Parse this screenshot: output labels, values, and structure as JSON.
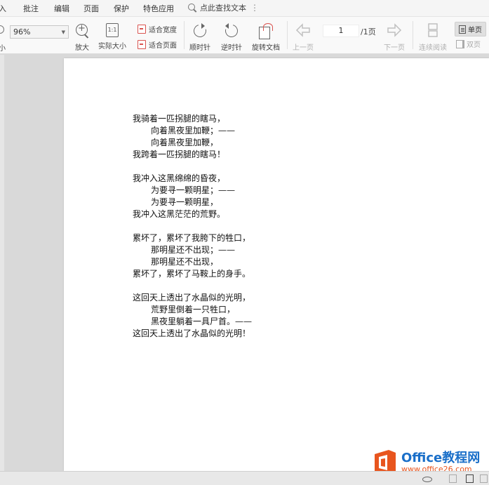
{
  "menu": {
    "items": [
      "入",
      "批注",
      "编辑",
      "页面",
      "保护",
      "特色应用"
    ],
    "search_label": "点此查找文本",
    "kebab": "⋮"
  },
  "toolbar": {
    "zoom_out_label": "小",
    "zoom_value": "96%",
    "zoom_in_label": "放大",
    "actual_size_label": "实际大小",
    "actual_size_icon_text": "1:1",
    "fit_width_label": "适合宽度",
    "fit_page_label": "适合页面",
    "rotate_cw_label": "顺时针",
    "rotate_ccw_label": "逆时针",
    "rotate_doc_label": "旋转文档",
    "prev_page_label": "上一页",
    "current_page": "1",
    "total_pages": "/1页",
    "next_page_label": "下一页",
    "continuous_label": "连续阅读",
    "single_page_label": "单页",
    "double_page_label": "双页"
  },
  "document": {
    "stanzas": [
      [
        "我骑着一匹拐腿的瞎马，",
        "向着黑夜里加鞭；——",
        "向着黑夜里加鞭，",
        "我跨着一匹拐腿的瞎马！"
      ],
      [
        "我冲入这黑绵绵的昏夜，",
        "为要寻一颗明星；——",
        "为要寻一颗明星，",
        "我冲入这黑茫茫的荒野。"
      ],
      [
        "累坏了，累坏了我胯下的牲口，",
        "那明星还不出现；——",
        "那明星还不出现，",
        "累坏了，累坏了马鞍上的身手。"
      ],
      [
        "这回天上透出了水晶似的光明，",
        "荒野里倒着一只牲口，",
        "黑夜里躺着一具尸首。——",
        "这回天上透出了水晶似的光明！"
      ]
    ]
  },
  "watermark": {
    "main": "Office教程网",
    "sub": "www.office26.com",
    "colors": {
      "blue": "#1a6fc9",
      "orange": "#e8551e"
    }
  }
}
